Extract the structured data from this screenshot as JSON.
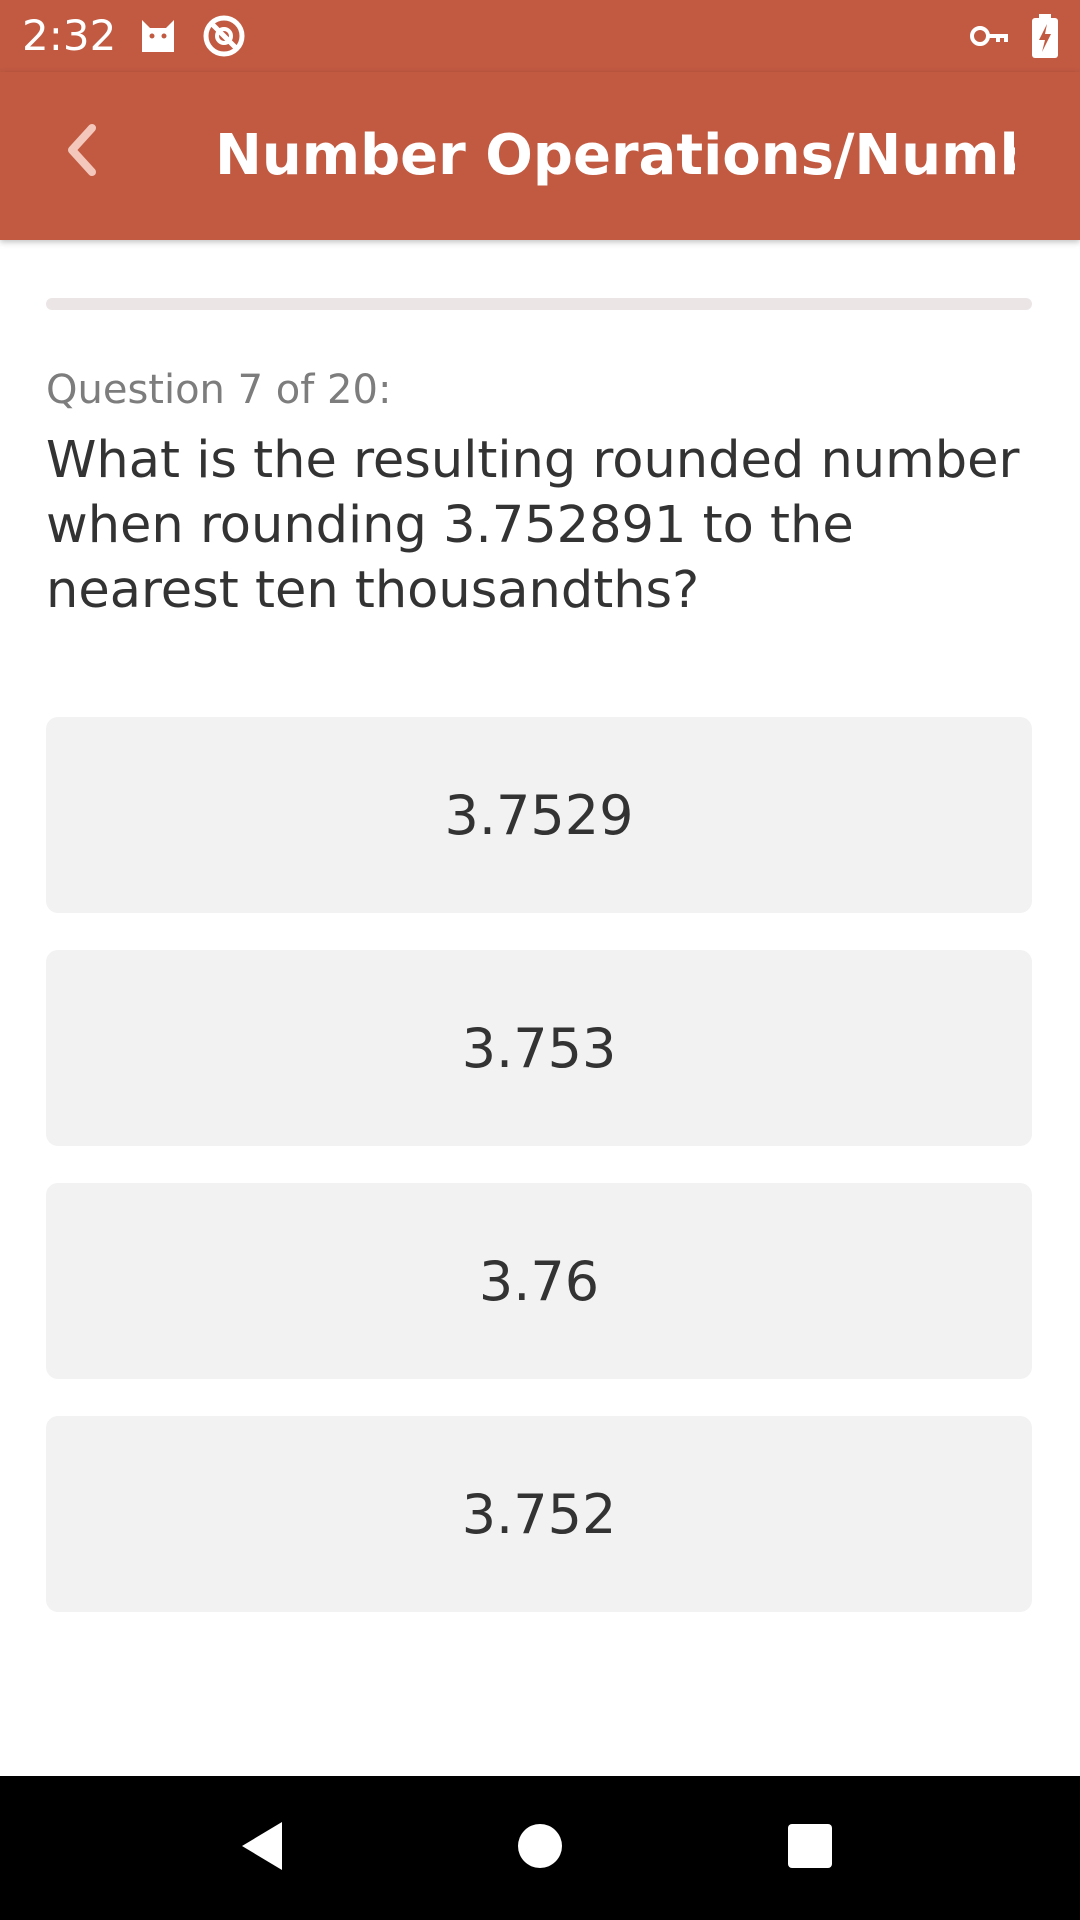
{
  "status_bar": {
    "time": "2:32",
    "icons": [
      "cat-notification-icon",
      "blocked-icon",
      "vpn-key-icon",
      "battery-charging-icon"
    ]
  },
  "app_bar": {
    "title": "Number Operations/Numbe…",
    "color": "#c25a42"
  },
  "progress": {
    "fraction": 0.0
  },
  "question": {
    "counter": "Question 7 of 20:",
    "text": "What is the resulting rounded number when rounding 3.752891 to the nearest ten thousandths?"
  },
  "answers": [
    {
      "label": "3.7529"
    },
    {
      "label": "3.753"
    },
    {
      "label": "3.76"
    },
    {
      "label": "3.752"
    }
  ],
  "nav_bar": {
    "buttons": [
      "back-triangle-icon",
      "home-circle-icon",
      "recents-square-icon"
    ]
  }
}
